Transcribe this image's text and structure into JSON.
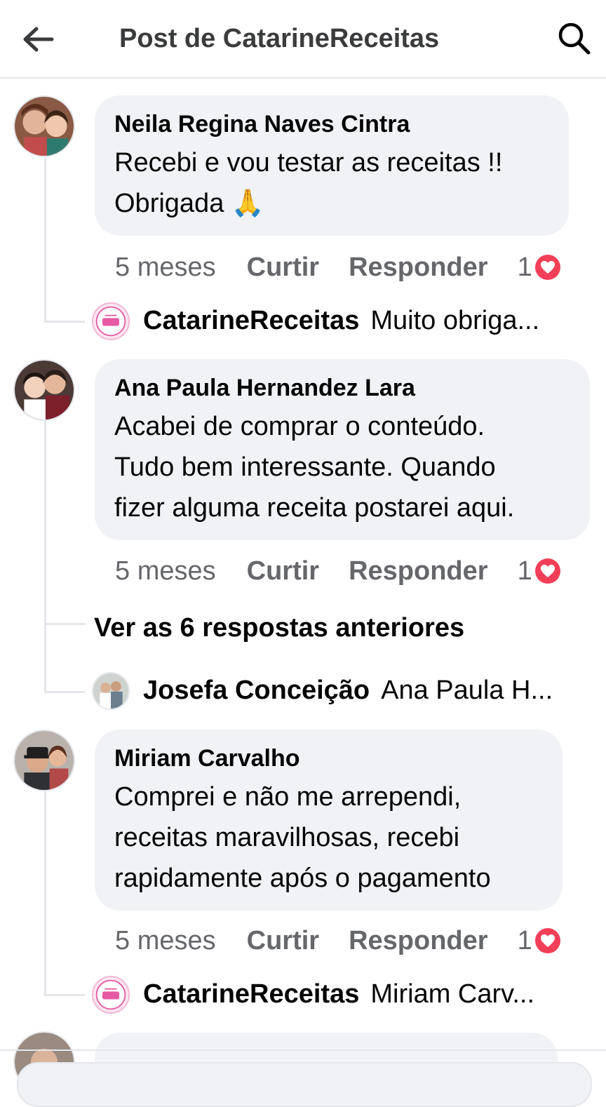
{
  "header": {
    "title": "Post de CatarineReceitas",
    "back_icon": "arrow-left-icon",
    "search_icon": "search-icon"
  },
  "colors": {
    "reaction_heart": "#f33e58",
    "bubble_bg": "#f0f2f5",
    "meta_text": "#65676b"
  },
  "comments": [
    {
      "author": "Neila Regina Naves Cintra",
      "text": "Recebi e vou testar as receitas !!\nObrigada 🙏",
      "time": "5 meses",
      "like_label": "Curtir",
      "reply_label": "Responder",
      "reaction_count": "1",
      "reply": {
        "name": "CatarineReceitas",
        "text": "Muito obriga..."
      }
    },
    {
      "author": "Ana Paula Hernandez Lara",
      "text": "Acabei de comprar o conteúdo.\nTudo bem interessante. Quando\nfizer alguma receita postarei aqui.",
      "time": "5 meses",
      "like_label": "Curtir",
      "reply_label": "Responder",
      "reaction_count": "1",
      "more_replies": "Ver as 6 respostas anteriores",
      "reply": {
        "name": "Josefa Conceição",
        "text": "Ana Paula H..."
      }
    },
    {
      "author": "Miriam Carvalho",
      "text": "Comprei e não me arrependi,\nreceitas maravilhosas, recebi\nrapidamente após o pagamento",
      "time": "5 meses",
      "like_label": "Curtir",
      "reply_label": "Responder",
      "reaction_count": "1",
      "reply": {
        "name": "CatarineReceitas",
        "text": "Miriam Carv..."
      }
    }
  ]
}
